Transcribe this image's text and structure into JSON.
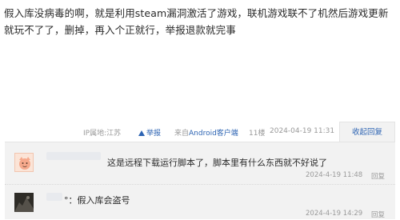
{
  "post": {
    "body": "假入库没病毒的啊，就是利用steam漏洞激活了游戏，联机游戏联不了机然后游戏更新就玩不了了，删掉，再入个正就行，举报退款就完事",
    "ip_location": "IP属地:江苏",
    "report_label": "举报",
    "client_prefix": "来自",
    "client_name": "Android客户端",
    "floor": "11楼",
    "datetime": "2024-04-19 11:31",
    "collapse_label": "收起回复"
  },
  "replies": [
    {
      "avatar_icon": "cartoon-avatar-icon",
      "text": "这是远程下载运行脚本了，脚本里有什么东西就不好说了",
      "datetime": "2024-4-19 11:48",
      "reply_label": "回复"
    },
    {
      "avatar_icon": "dark-photo-avatar-icon",
      "text": "°：假入库会盗号",
      "datetime": "2024-4-19 14:29",
      "reply_label": "回复"
    }
  ],
  "colors": {
    "link": "#2d64b3",
    "meta_text": "#999999",
    "reply_panel_bg": "#f2f2f2"
  }
}
